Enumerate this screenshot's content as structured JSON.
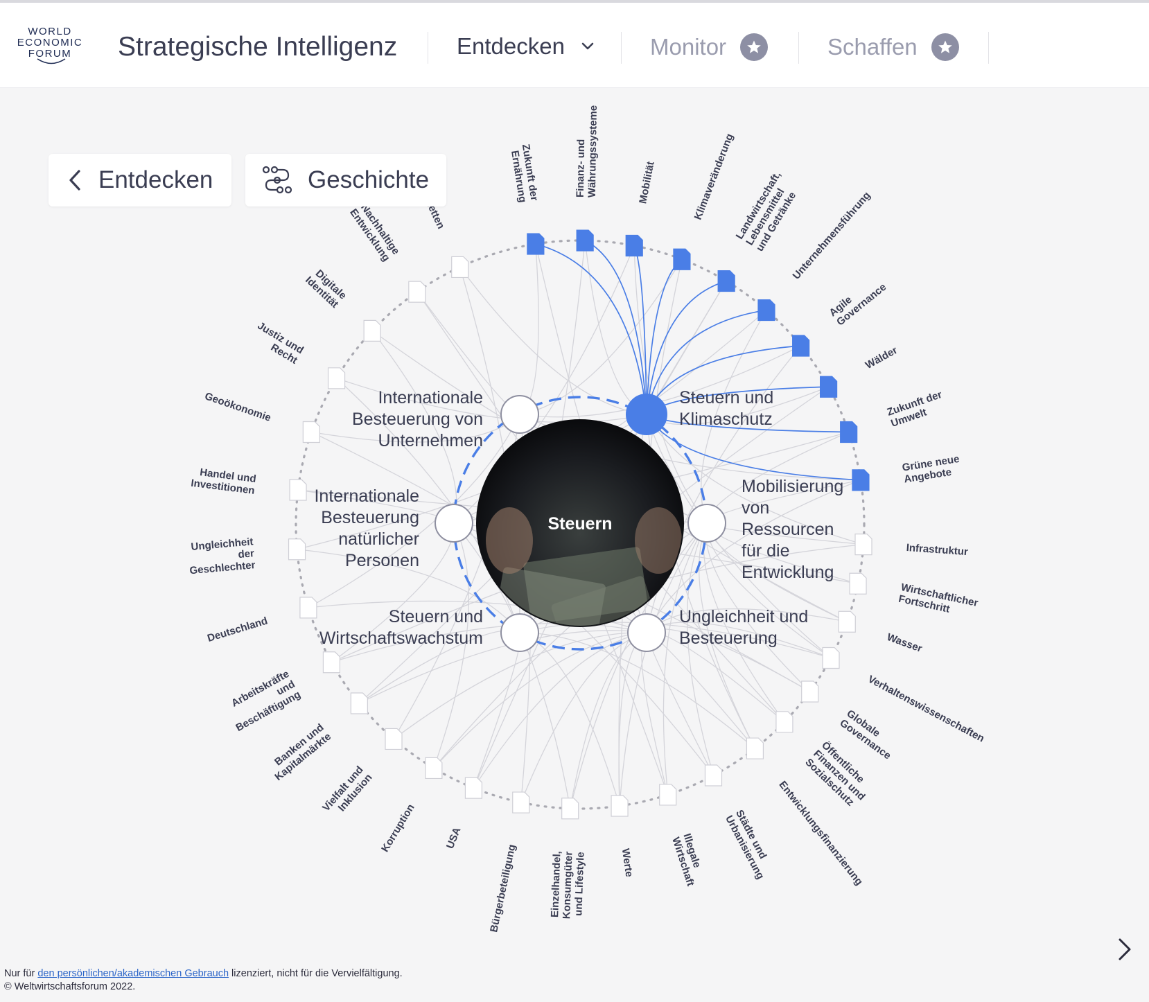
{
  "header": {
    "logo_lines": [
      "WORLD",
      "ECONOMIC",
      "FORUM"
    ],
    "app_title": "Strategische Intelligenz",
    "nav": [
      {
        "label": "Entdecken",
        "icon": "chevron-down-icon"
      },
      {
        "label": "Monitor",
        "icon": "star-icon"
      },
      {
        "label": "Schaffen",
        "icon": "star-icon"
      }
    ]
  },
  "controls": {
    "back_label": "Entdecken",
    "story_label": "Geschichte"
  },
  "center": {
    "label": "Steuern"
  },
  "key_issues": [
    "Internationale\nBesteuerung von\nUnternehmen",
    "Steuern und\nKlimaschutz",
    "Mobilisierung\nvon\nRessourcen\nfür die\nEntwicklung",
    "Ungleichheit und\nBesteuerung",
    "Steuern und\nWirtschaftswachstum",
    "Internationale\nBesteuerung\nnatürlicher\nPersonen"
  ],
  "selected_key_issue": "Steuern und\nKlimaschutz",
  "topics": [
    "Zukunft der\nErnährung",
    "Finanz- und\nWährungssysteme",
    "Mobilität",
    "Klimaveränderung",
    "Landwirtschaft,\nLebensmittel\nund Getränke",
    "Unternehmensführung",
    "Agile\nGovernance",
    "Wälder",
    "Zukunft der\nUmwelt",
    "Grüne neue\nAngebote",
    "Infrastruktur",
    "Wirtschaftlicher\nFortschritt",
    "Wasser",
    "Verhaltenswissenschaften",
    "Globale\nGovernance",
    "Öffentliche\nFinanzen und\nSozialschutz",
    "Entwicklungsfinanzierung",
    "Städte und\nUrbanisierung",
    "Illegale\nWirtschaft",
    "Werte",
    "Einzelhandel,\nKonsumgüter\nund Lifestyle",
    "Bürgerbeteiligung",
    "USA",
    "Korruption",
    "Vielfalt und\nInklusion",
    "Banken und\nKapitalmärkte",
    "Arbeitskräfte\nund\nBeschäftigung",
    "Deutschland",
    "Ungleichheit\nder\nGeschlechter",
    "Handel und\nInvestitionen",
    "Geoökonomie",
    "Justiz und\nRecht",
    "Digitale\nIdentität",
    "Nachhaltige\nEntwicklung",
    "ketten"
  ],
  "highlighted_topics": [
    "Zukunft der\nErnährung",
    "Finanz- und\nWährungssysteme",
    "Mobilität",
    "Klimaveränderung",
    "Landwirtschaft,\nLebensmittel\nund Getränke",
    "Unternehmensführung",
    "Agile\nGovernance",
    "Wälder",
    "Zukunft der\nUmwelt",
    "Grüne neue\nAngebote"
  ],
  "footer": {
    "line1_before": "Nur für ",
    "line1_link": "den persönlichen/akademischen Gebrauch",
    "line1_after": " lizenziert, nicht für die Vervielfältigung.",
    "line2": "© Weltwirtschaftsforum 2022."
  },
  "colors": {
    "accent": "#4a7ee6",
    "link": "#2a64c8",
    "text": "#2b2b3b",
    "muted": "#9a9cae",
    "background": "#f5f5f6"
  }
}
